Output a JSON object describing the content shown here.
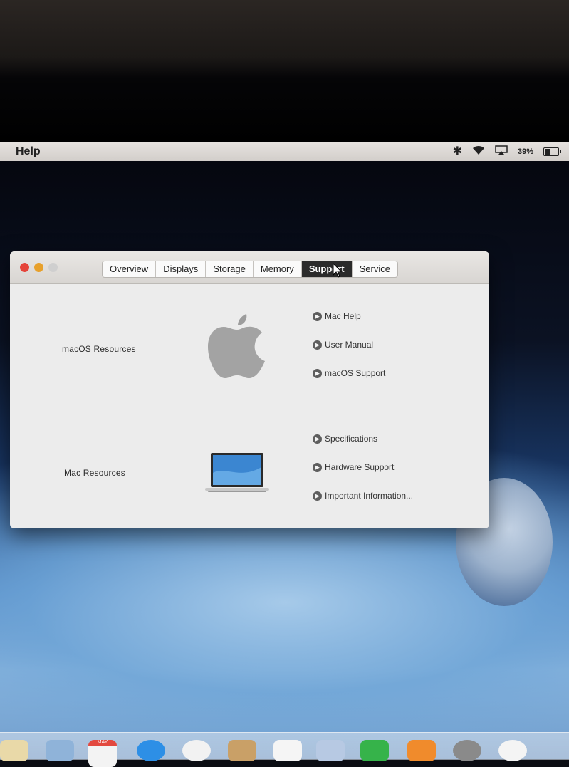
{
  "menubar": {
    "help_label": "Help",
    "battery_percent": "39%",
    "battery_level": 0.39,
    "icons": [
      "bluetooth-icon",
      "wifi-icon",
      "airplay-icon",
      "battery-icon"
    ]
  },
  "window": {
    "tabs": [
      {
        "label": "Overview",
        "selected": false
      },
      {
        "label": "Displays",
        "selected": false
      },
      {
        "label": "Storage",
        "selected": false
      },
      {
        "label": "Memory",
        "selected": false
      },
      {
        "label": "Support",
        "selected": true
      },
      {
        "label": "Service",
        "selected": false
      }
    ],
    "sections": {
      "macos": {
        "label": "macOS Resources",
        "links": [
          "Mac Help",
          "User Manual",
          "macOS Support"
        ]
      },
      "mac": {
        "label": "Mac Resources",
        "links": [
          "Specifications",
          "Hardware Support",
          "Important Information..."
        ]
      }
    }
  },
  "dock": {
    "calendar_month": "MAY"
  },
  "colors": {
    "close": "#e5443a",
    "minimize": "#e7a02b",
    "zoom_inactive": "#cfcfcf",
    "selected_tab": "#2b2b2b"
  }
}
